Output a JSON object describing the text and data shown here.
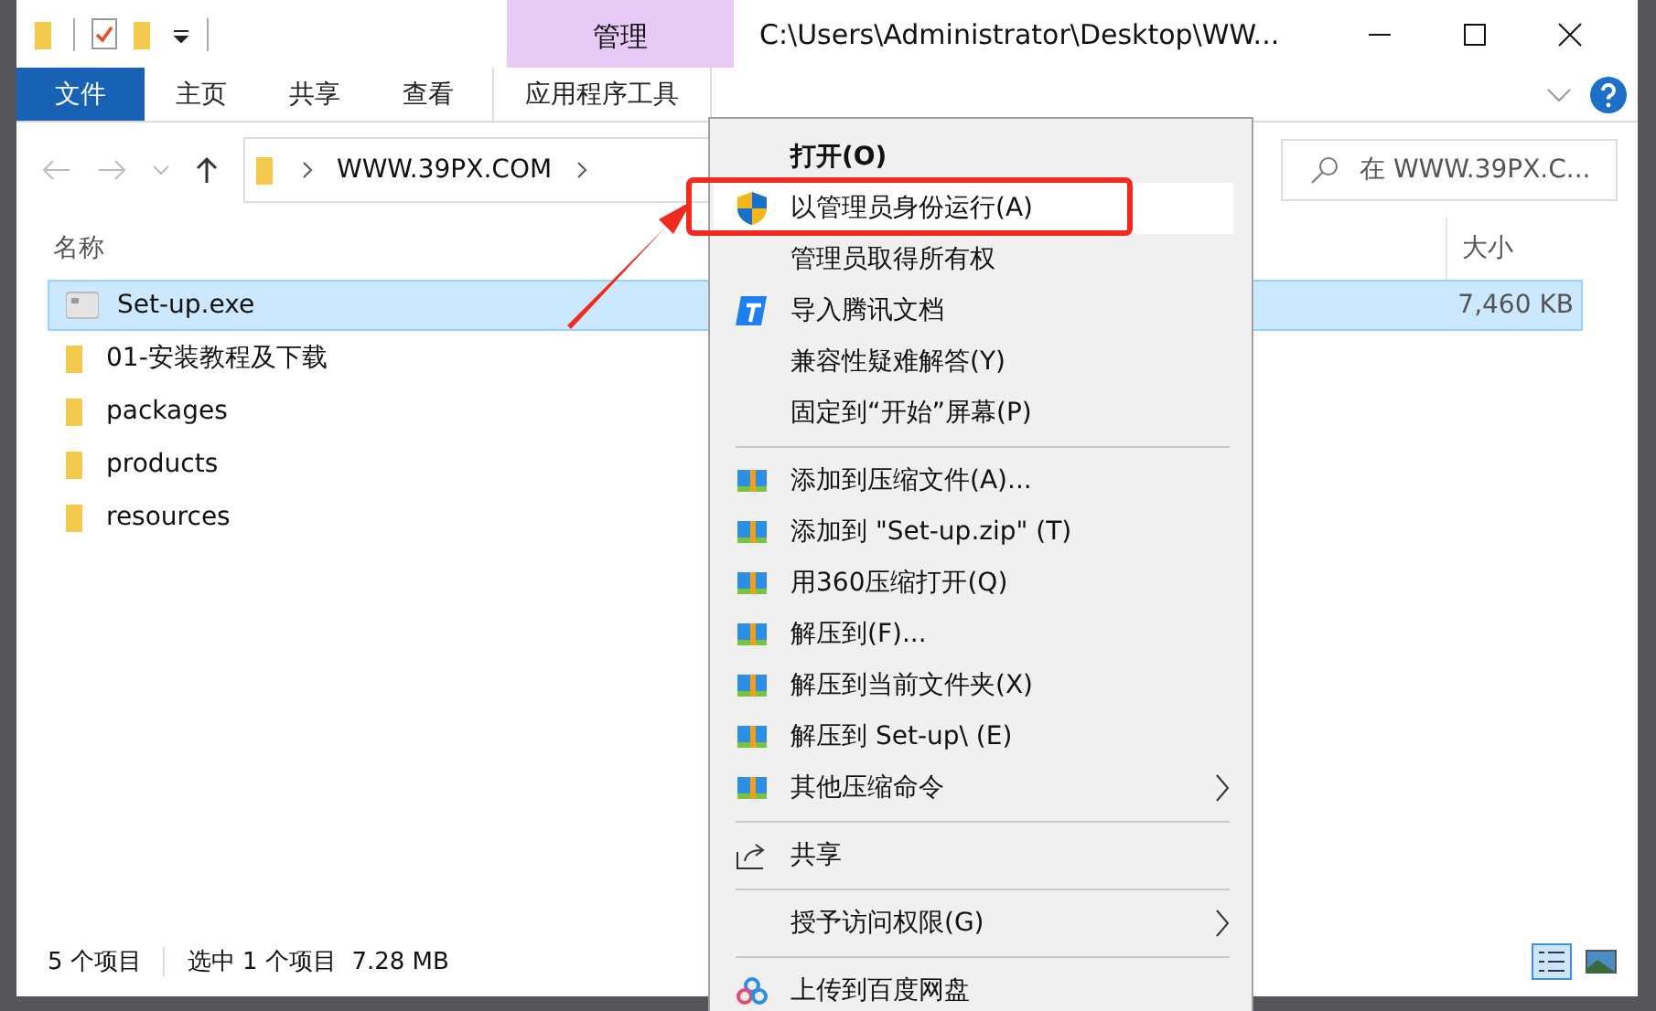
{
  "window": {
    "title": "C:\\Users\\Administrator\\Desktop\\WW...",
    "context_tab": "管理"
  },
  "ribbon_tabs": [
    {
      "label": "文件",
      "kind": "file"
    },
    {
      "label": "主页",
      "kind": "tab"
    },
    {
      "label": "共享",
      "kind": "tab"
    },
    {
      "label": "查看",
      "kind": "tab"
    },
    {
      "label": "应用程序工具",
      "kind": "context"
    }
  ],
  "address": {
    "crumbs": [
      "WWW.39PX.COM"
    ],
    "search_placeholder": "在 WWW.39PX.C..."
  },
  "columns": [
    "名称",
    "大小"
  ],
  "files": [
    {
      "name": "Set-up.exe",
      "kind": "exe",
      "size": "7,460 KB",
      "selected": true
    },
    {
      "name": "01-安装教程及下载",
      "kind": "folder",
      "selected": false
    },
    {
      "name": "packages",
      "kind": "folder",
      "selected": false
    },
    {
      "name": "products",
      "kind": "folder",
      "selected": false
    },
    {
      "name": "resources",
      "kind": "folder",
      "selected": false
    }
  ],
  "status_bar": {
    "count": "5 个项目",
    "selection": "选中 1 个项目  7.28 MB"
  },
  "context_menu": [
    {
      "kind": "plain",
      "label": "打开(O)",
      "default": true,
      "selected": false
    },
    {
      "kind": "shield",
      "label": "以管理员身份运行(A)",
      "selected": true,
      "marked": true
    },
    {
      "kind": "plain",
      "label": "管理员取得所有权",
      "selected": false
    },
    {
      "kind": "doc",
      "label": "导入腾讯文档",
      "selected": false
    },
    {
      "kind": "plain",
      "label": "兼容性疑难解答(Y)",
      "selected": false
    },
    {
      "kind": "plain",
      "label": "固定到“开始”屏幕(P)",
      "selected": false
    },
    {
      "kind": "separator"
    },
    {
      "kind": "archive",
      "label": "添加到压缩文件(A)...",
      "selected": false
    },
    {
      "kind": "archive",
      "label": "添加到 \"Set-up.zip\" (T)",
      "selected": false
    },
    {
      "kind": "archive",
      "label": "用360压缩打开(Q)",
      "selected": false
    },
    {
      "kind": "archive",
      "label": "解压到(F)...",
      "selected": false
    },
    {
      "kind": "archive",
      "label": "解压到当前文件夹(X)",
      "selected": false
    },
    {
      "kind": "archive",
      "label": "解压到 Set-up\\ (E)",
      "selected": false
    },
    {
      "kind": "archive",
      "label": "其他压缩命令",
      "submenu": true,
      "selected": false
    },
    {
      "kind": "separator"
    },
    {
      "kind": "share",
      "label": "共享",
      "selected": false
    },
    {
      "kind": "separator"
    },
    {
      "kind": "plain",
      "label": "授予访问权限(G)",
      "submenu": true,
      "selected": false
    },
    {
      "kind": "separator"
    },
    {
      "kind": "cloud",
      "label": "上传到百度网盘",
      "selected": false
    }
  ]
}
